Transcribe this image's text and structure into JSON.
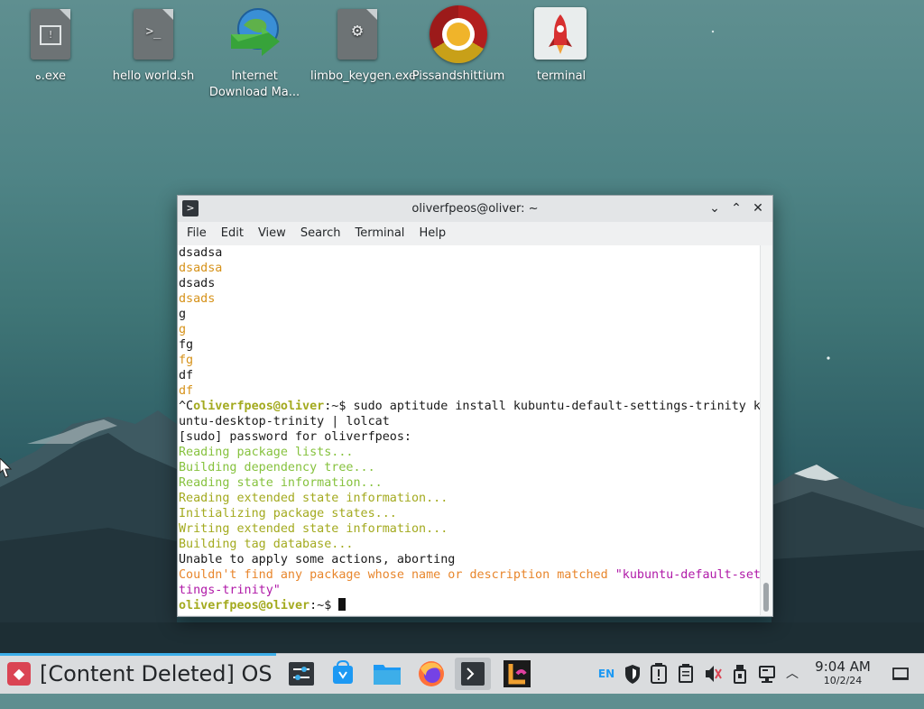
{
  "desktop": {
    "icons": [
      {
        "label": "ﻩ.exe",
        "icon": "exe-file-icon"
      },
      {
        "label": "hello world.sh",
        "icon": "shell-script-icon"
      },
      {
        "label": "Internet Download Ma...",
        "icon": "internet-download-manager-icon"
      },
      {
        "label": "limbo_keygen.exe",
        "icon": "exe-gear-file-icon"
      },
      {
        "label": "Pissandshittium",
        "icon": "chromium-icon"
      },
      {
        "label": "terminal",
        "icon": "rocket-app-icon"
      }
    ]
  },
  "window": {
    "title": "oliverfpeos@oliver: ~",
    "menu": [
      "File",
      "Edit",
      "View",
      "Search",
      "Terminal",
      "Help"
    ]
  },
  "terminal": {
    "lines": [
      {
        "text": "dsadsa",
        "color": "#1a1a1a"
      },
      {
        "text": "dsadsa",
        "color": "#d6921a"
      },
      {
        "text": "dsads",
        "color": "#1a1a1a"
      },
      {
        "text": "dsads",
        "color": "#d6921a"
      },
      {
        "text": "g",
        "color": "#1a1a1a"
      },
      {
        "text": "g",
        "color": "#d6921a"
      },
      {
        "text": "fg",
        "color": "#1a1a1a"
      },
      {
        "text": "fg",
        "color": "#d6921a"
      },
      {
        "text": "df",
        "color": "#1a1a1a"
      },
      {
        "text": "df",
        "color": "#d6921a"
      }
    ],
    "prompt_line": {
      "prefix": "^C",
      "user": "oliverfpeos@oliver",
      "path": ":~$ ",
      "command": "sudo aptitude install kubuntu-default-settings-trinity k"
    },
    "wrapped_command": "untu-desktop-trinity | lolcat",
    "sudo_prompt": "[sudo] password for oliverfpeos:",
    "progress_lines": [
      "Reading package lists...",
      "Building dependency tree...",
      "Reading state information...",
      "Reading extended state information...",
      "Initializing package states...",
      "Writing extended state information...",
      "Building tag database..."
    ],
    "error_line": "Unable to apply some actions, aborting",
    "error_detail": [
      "Couldn't find any package whose name or description matched \"kubuntu-default-set",
      "tings-trinity\""
    ],
    "final_prompt": {
      "user": "oliverfpeos@oliver",
      "path": ":~$ "
    }
  },
  "taskbar": {
    "start_label": "[Content Deleted] OS",
    "apps": [
      {
        "name": "system-settings-icon"
      },
      {
        "name": "software-center-icon"
      },
      {
        "name": "file-manager-icon"
      },
      {
        "name": "firefox-icon"
      },
      {
        "name": "konsole-icon"
      },
      {
        "name": "lolcat-app-icon"
      }
    ],
    "tray": {
      "language": "EN",
      "time": "9:04 AM",
      "date": "10/2/24"
    }
  },
  "colors": {
    "accent": "#3daee9",
    "start": "#da4453",
    "prompt_user": "#a3aa1f",
    "lolcat_orange": "#d6921a",
    "lolcat_green": "#86c23e",
    "lolcat_magenta": "#b01aa8"
  }
}
